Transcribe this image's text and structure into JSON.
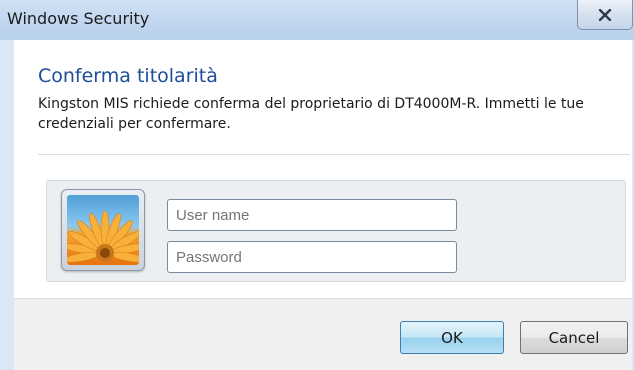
{
  "window": {
    "title": "Windows Security"
  },
  "dialog": {
    "heading": "Conferma titolarità",
    "message": "Kingston MIS richiede conferma del proprietario di DT4000M-R. Immetti le tue credenziali per confermare."
  },
  "credentials": {
    "username_placeholder": "User name",
    "password_placeholder": "Password"
  },
  "buttons": {
    "ok_label": "OK",
    "cancel_label": "Cancel"
  },
  "colors": {
    "heading": "#1e4d9a",
    "ok_border": "#3c7fb1",
    "titlebar": "#c0d6ef"
  },
  "icons": {
    "close": "close-icon",
    "avatar": "user-avatar-flower"
  }
}
